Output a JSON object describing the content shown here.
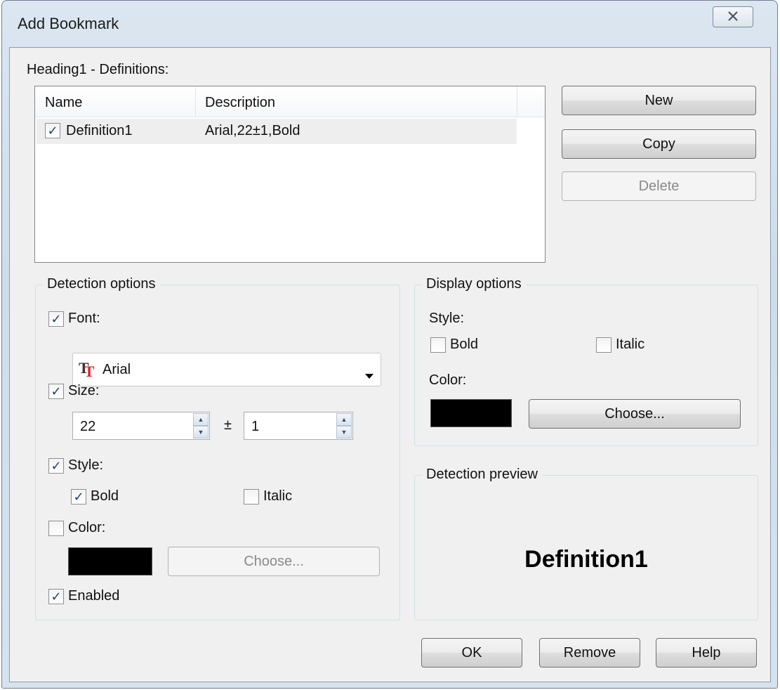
{
  "window": {
    "title": "Add Bookmark"
  },
  "definitions": {
    "label": "Heading1 - Definitions:",
    "columns": [
      "Name",
      "Description"
    ],
    "rows": [
      {
        "name": "Definition1",
        "description": "Arial,22±1,Bold",
        "checked": true
      }
    ]
  },
  "side_buttons": {
    "new": "New",
    "copy": "Copy",
    "delete": "Delete"
  },
  "detection": {
    "group_title": "Detection options",
    "font_label": "Font:",
    "font_value": "Arial",
    "size_label": "Size:",
    "size_value": "22",
    "plusminus": "±",
    "tolerance_value": "1",
    "style_label": "Style:",
    "bold_label": "Bold",
    "italic_label": "Italic",
    "color_label": "Color:",
    "choose_label": "Choose...",
    "enabled_label": "Enabled",
    "swatch_color": "#000000"
  },
  "display": {
    "group_title": "Display options",
    "style_label": "Style:",
    "bold_label": "Bold",
    "italic_label": "Italic",
    "color_label": "Color:",
    "choose_label": "Choose...",
    "swatch_color": "#000000"
  },
  "preview": {
    "group_title": "Detection preview",
    "text": "Definition1"
  },
  "footer": {
    "ok": "OK",
    "remove": "Remove",
    "help": "Help"
  },
  "icons": {
    "close": "close-icon",
    "font_type": "truetype-font-icon",
    "dropdown": "chevron-down-icon"
  }
}
